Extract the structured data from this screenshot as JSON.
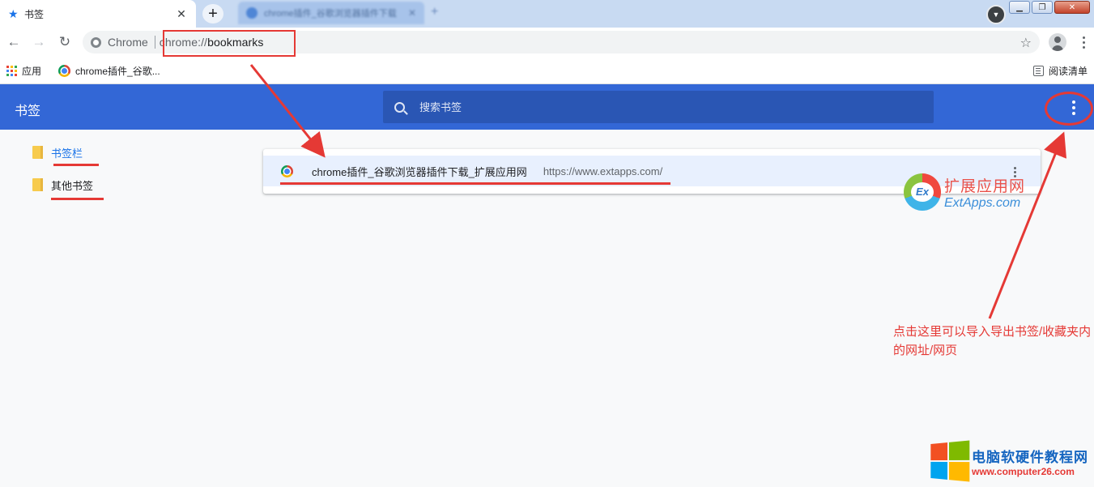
{
  "tab": {
    "active_title": "书签",
    "background_title": "chrome插件_谷歌浏览器插件下载"
  },
  "toolbar": {
    "omnibox_chip": "Chrome",
    "url_scheme": "chrome://",
    "url_path": "bookmarks"
  },
  "bookmarks_bar": {
    "apps_label": "应用",
    "item_label": "chrome插件_谷歌...",
    "reading_list_label": "阅读清单"
  },
  "manager": {
    "title": "书签",
    "search_placeholder": "搜索书签"
  },
  "sidebar": {
    "folders": [
      {
        "label": "书签栏",
        "selected": true
      },
      {
        "label": "其他书签",
        "selected": false
      }
    ]
  },
  "list": {
    "items": [
      {
        "title": "chrome插件_谷歌浏览器插件下载_扩展应用网",
        "url": "https://www.extapps.com/"
      }
    ]
  },
  "annotation": {
    "note_text": "点击这里可以导入导出书签/收藏夹内的网址/网页"
  },
  "watermarks": {
    "ext_cn": "扩展应用网",
    "ext_en": "ExtApps.com",
    "pc_cn": "电脑软硬件教程网",
    "pc_en": "www.computer26.com"
  },
  "colors": {
    "header_blue": "#3367d6",
    "search_blue": "#2a56b4",
    "annotation_red": "#e53935",
    "selected_text": "#1a73e8",
    "folder_yellow": "#f7cb4d"
  }
}
